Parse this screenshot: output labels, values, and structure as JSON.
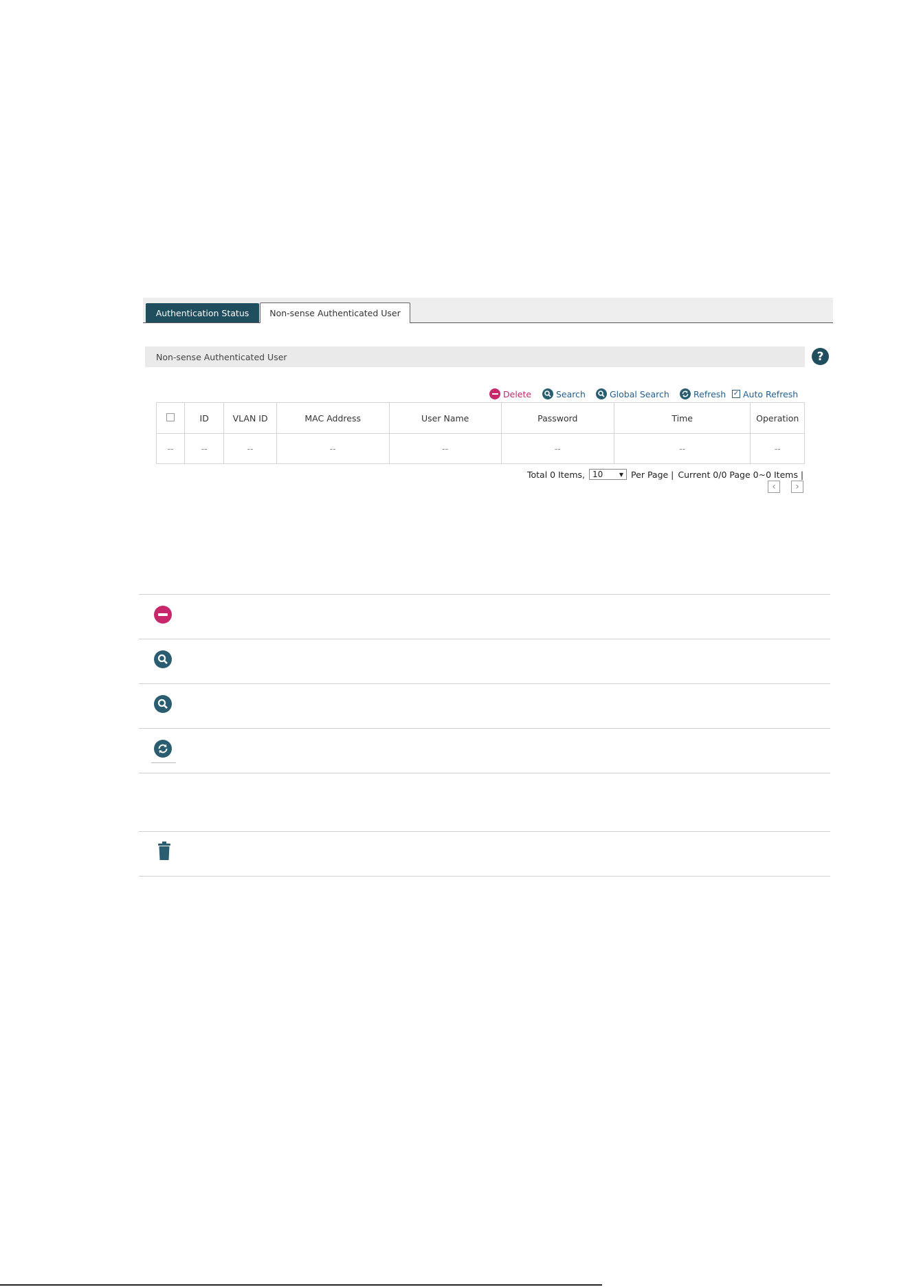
{
  "tabs": [
    {
      "label": "Authentication Status",
      "active": true
    },
    {
      "label": "Non-sense Authenticated User",
      "active": false
    }
  ],
  "section_title": "Non-sense Authenticated User",
  "help_label": "?",
  "toolbar": {
    "delete": "Delete",
    "search": "Search",
    "global_search": "Global Search",
    "refresh": "Refresh",
    "auto_refresh": "Auto Refresh",
    "auto_refresh_checked": true
  },
  "table": {
    "headers": [
      "ID",
      "VLAN ID",
      "MAC Address",
      "User Name",
      "Password",
      "Time",
      "Operation"
    ],
    "row": [
      "--",
      "--",
      "--",
      "--",
      "--",
      "--",
      "--",
      "--"
    ]
  },
  "pager": {
    "total": "Total 0 Items,",
    "per_page_value": "10",
    "per_page_label": "Per Page |",
    "current": "Current 0/0 Page 0~0 Items |"
  },
  "colors": {
    "accent": "#1f4e5f",
    "delete": "#c8286b",
    "link": "#1f5e8f"
  },
  "legend_icons": [
    "delete-icon",
    "search-icon",
    "global-search-icon",
    "refresh-icon",
    "trash-icon"
  ]
}
